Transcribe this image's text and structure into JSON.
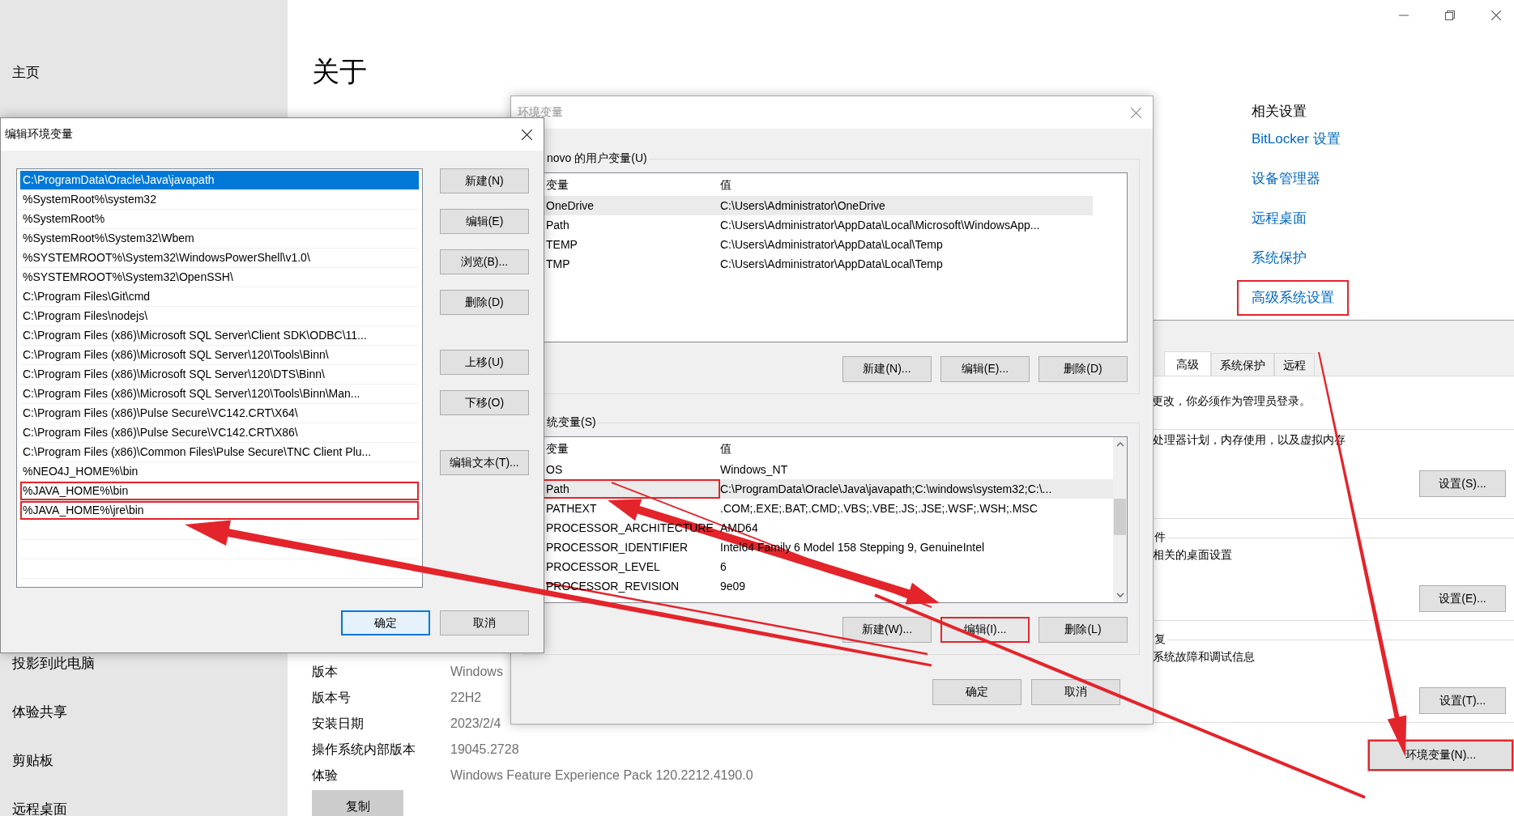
{
  "settings": {
    "sidebar_top": [
      "主页"
    ],
    "sidebar_bottom": [
      "投影到此电脑",
      "体验共享",
      "剪贴板",
      "远程桌面"
    ],
    "title": "关于",
    "specs": [
      {
        "label": "版本",
        "value": "Windows"
      },
      {
        "label": "版本号",
        "value": "22H2"
      },
      {
        "label": "安装日期",
        "value": "2023/2/4"
      },
      {
        "label": "操作系统内部版本",
        "value": "19045.2728"
      },
      {
        "label": "体验",
        "value": "Windows Feature Experience Pack 120.2212.4190.0"
      }
    ],
    "copy_button": "复制",
    "related_title": "相关设置",
    "related_links": [
      {
        "label": "BitLocker 设置",
        "highlighted": false
      },
      {
        "label": "设备管理器",
        "highlighted": false
      },
      {
        "label": "远程桌面",
        "highlighted": false
      },
      {
        "label": "系统保护",
        "highlighted": false
      },
      {
        "label": "高级系统设置",
        "highlighted": true
      }
    ]
  },
  "system_properties": {
    "tabs": [
      {
        "label": "高级",
        "selected": true
      },
      {
        "label": "系统保护",
        "selected": false
      },
      {
        "label": "远程",
        "selected": false
      }
    ],
    "admin_note": "更改，你必须作为管理员登录。",
    "sections": [
      {
        "description": "处理器计划，内存使用，以及虚拟内存",
        "button": "设置(S)..."
      },
      {
        "heading": "件",
        "description": "相关的桌面设置",
        "button": "设置(E)..."
      },
      {
        "heading": "复",
        "description": "系统故障和调试信息",
        "button": "设置(T)..."
      }
    ],
    "env_button": {
      "label": "环境变量(N)...",
      "highlighted": true
    }
  },
  "env_window": {
    "title": "环境变量",
    "user_group": "novo 的用户变量(U)",
    "user_columns": [
      "变量",
      "值"
    ],
    "user_rows": [
      {
        "name": "OneDrive",
        "value": "C:\\Users\\Administrator\\OneDrive",
        "selected": true
      },
      {
        "name": "Path",
        "value": "C:\\Users\\Administrator\\AppData\\Local\\Microsoft\\WindowsApp...",
        "selected": false
      },
      {
        "name": "TEMP",
        "value": "C:\\Users\\Administrator\\AppData\\Local\\Temp",
        "selected": false
      },
      {
        "name": "TMP",
        "value": "C:\\Users\\Administrator\\AppData\\Local\\Temp",
        "selected": false
      }
    ],
    "user_buttons": [
      {
        "label": "新建(N)...",
        "highlighted": false
      },
      {
        "label": "编辑(E)...",
        "highlighted": false
      },
      {
        "label": "删除(D)",
        "highlighted": false
      }
    ],
    "system_group": "统变量(S)",
    "system_columns": [
      "变量",
      "值"
    ],
    "system_rows": [
      {
        "name": "OS",
        "value": "Windows_NT",
        "selected": false,
        "highlighted": false
      },
      {
        "name": "Path",
        "value": "C:\\ProgramData\\Oracle\\Java\\javapath;C:\\windows\\system32;C:\\...",
        "selected": true,
        "highlighted": true
      },
      {
        "name": "PATHEXT",
        "value": ".COM;.EXE;.BAT;.CMD;.VBS;.VBE;.JS;.JSE;.WSF;.WSH;.MSC",
        "selected": false,
        "highlighted": false
      },
      {
        "name": "PROCESSOR_ARCHITECTURE",
        "value": "AMD64",
        "selected": false,
        "highlighted": false
      },
      {
        "name": "PROCESSOR_IDENTIFIER",
        "value": "Intel64 Family 6 Model 158 Stepping 9, GenuineIntel",
        "selected": false,
        "highlighted": false
      },
      {
        "name": "PROCESSOR_LEVEL",
        "value": "6",
        "selected": false,
        "highlighted": false
      },
      {
        "name": "PROCESSOR_REVISION",
        "value": "9e09",
        "selected": false,
        "highlighted": false
      }
    ],
    "system_buttons": [
      {
        "label": "新建(W)...",
        "highlighted": false
      },
      {
        "label": "编辑(I)...",
        "highlighted": true
      },
      {
        "label": "删除(L)",
        "highlighted": false
      }
    ],
    "footer_buttons": [
      {
        "label": "确定",
        "default": false
      },
      {
        "label": "取消",
        "default": false
      }
    ]
  },
  "edit_dialog": {
    "title": "编辑环境变量",
    "entries": [
      {
        "text": "C:\\ProgramData\\Oracle\\Java\\javapath",
        "selected": true,
        "highlighted": false
      },
      {
        "text": "%SystemRoot%\\system32",
        "selected": false,
        "highlighted": false
      },
      {
        "text": "%SystemRoot%",
        "selected": false,
        "highlighted": false
      },
      {
        "text": "%SystemRoot%\\System32\\Wbem",
        "selected": false,
        "highlighted": false
      },
      {
        "text": "%SYSTEMROOT%\\System32\\WindowsPowerShell\\v1.0\\",
        "selected": false,
        "highlighted": false
      },
      {
        "text": "%SYSTEMROOT%\\System32\\OpenSSH\\",
        "selected": false,
        "highlighted": false
      },
      {
        "text": "C:\\Program Files\\Git\\cmd",
        "selected": false,
        "highlighted": false
      },
      {
        "text": "C:\\Program Files\\nodejs\\",
        "selected": false,
        "highlighted": false
      },
      {
        "text": "C:\\Program Files (x86)\\Microsoft SQL Server\\Client SDK\\ODBC\\11...",
        "selected": false,
        "highlighted": false
      },
      {
        "text": "C:\\Program Files (x86)\\Microsoft SQL Server\\120\\Tools\\Binn\\",
        "selected": false,
        "highlighted": false
      },
      {
        "text": "C:\\Program Files (x86)\\Microsoft SQL Server\\120\\DTS\\Binn\\",
        "selected": false,
        "highlighted": false
      },
      {
        "text": "C:\\Program Files (x86)\\Microsoft SQL Server\\120\\Tools\\Binn\\Man...",
        "selected": false,
        "highlighted": false
      },
      {
        "text": "C:\\Program Files (x86)\\Pulse Secure\\VC142.CRT\\X64\\",
        "selected": false,
        "highlighted": false
      },
      {
        "text": "C:\\Program Files (x86)\\Pulse Secure\\VC142.CRT\\X86\\",
        "selected": false,
        "highlighted": false
      },
      {
        "text": "C:\\Program Files (x86)\\Common Files\\Pulse Secure\\TNC Client Plu...",
        "selected": false,
        "highlighted": false
      },
      {
        "text": "%NEO4J_HOME%\\bin",
        "selected": false,
        "highlighted": false
      },
      {
        "text": "%JAVA_HOME%\\bin",
        "selected": false,
        "highlighted": true
      },
      {
        "text": "%JAVA_HOME%\\jre\\bin",
        "selected": false,
        "highlighted": true
      }
    ],
    "button_groups": [
      [
        "新建(N)",
        "编辑(E)",
        "浏览(B)...",
        "删除(D)"
      ],
      [
        "上移(U)",
        "下移(O)"
      ],
      [
        "编辑文本(T)..."
      ]
    ],
    "footer_buttons": [
      {
        "label": "确定",
        "default": true
      },
      {
        "label": "取消",
        "default": false
      }
    ]
  }
}
